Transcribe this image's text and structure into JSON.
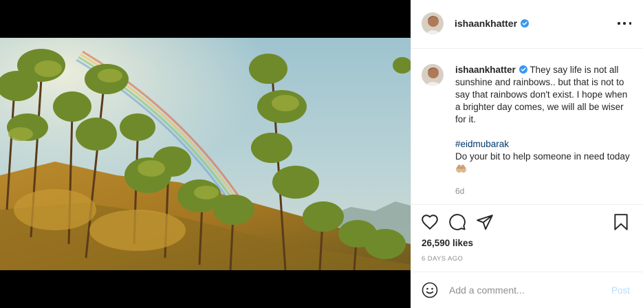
{
  "post": {
    "username": "ishaankhatter",
    "verified": true,
    "media_alt": "Rainbow over pine trees on a hillside"
  },
  "caption": {
    "username": "ishaankhatter",
    "line1": "They say life is not all sunshine and rainbows.. but that is not to say that rainbows don't exist. I hope when a brighter day comes, we will all be wiser for it.",
    "hashtag": "#eidmubarak",
    "line2": "Do your bit to help someone in need today 🤲🏼",
    "time": "6d"
  },
  "stats": {
    "likes": "26,590 likes",
    "date": "6 DAYS AGO"
  },
  "comment": {
    "placeholder": "Add a comment...",
    "post_label": "Post"
  },
  "icons": {
    "verified": "verified-badge-icon",
    "more": "more-options-icon",
    "like": "heart-icon",
    "comment": "comment-bubble-icon",
    "share": "paper-plane-icon",
    "save": "bookmark-icon",
    "emoji": "emoji-icon"
  },
  "colors": {
    "verified": "#3897f0",
    "link": "#00376b",
    "muted": "#8e8e8e",
    "post_disabled": "#b2dffc"
  }
}
